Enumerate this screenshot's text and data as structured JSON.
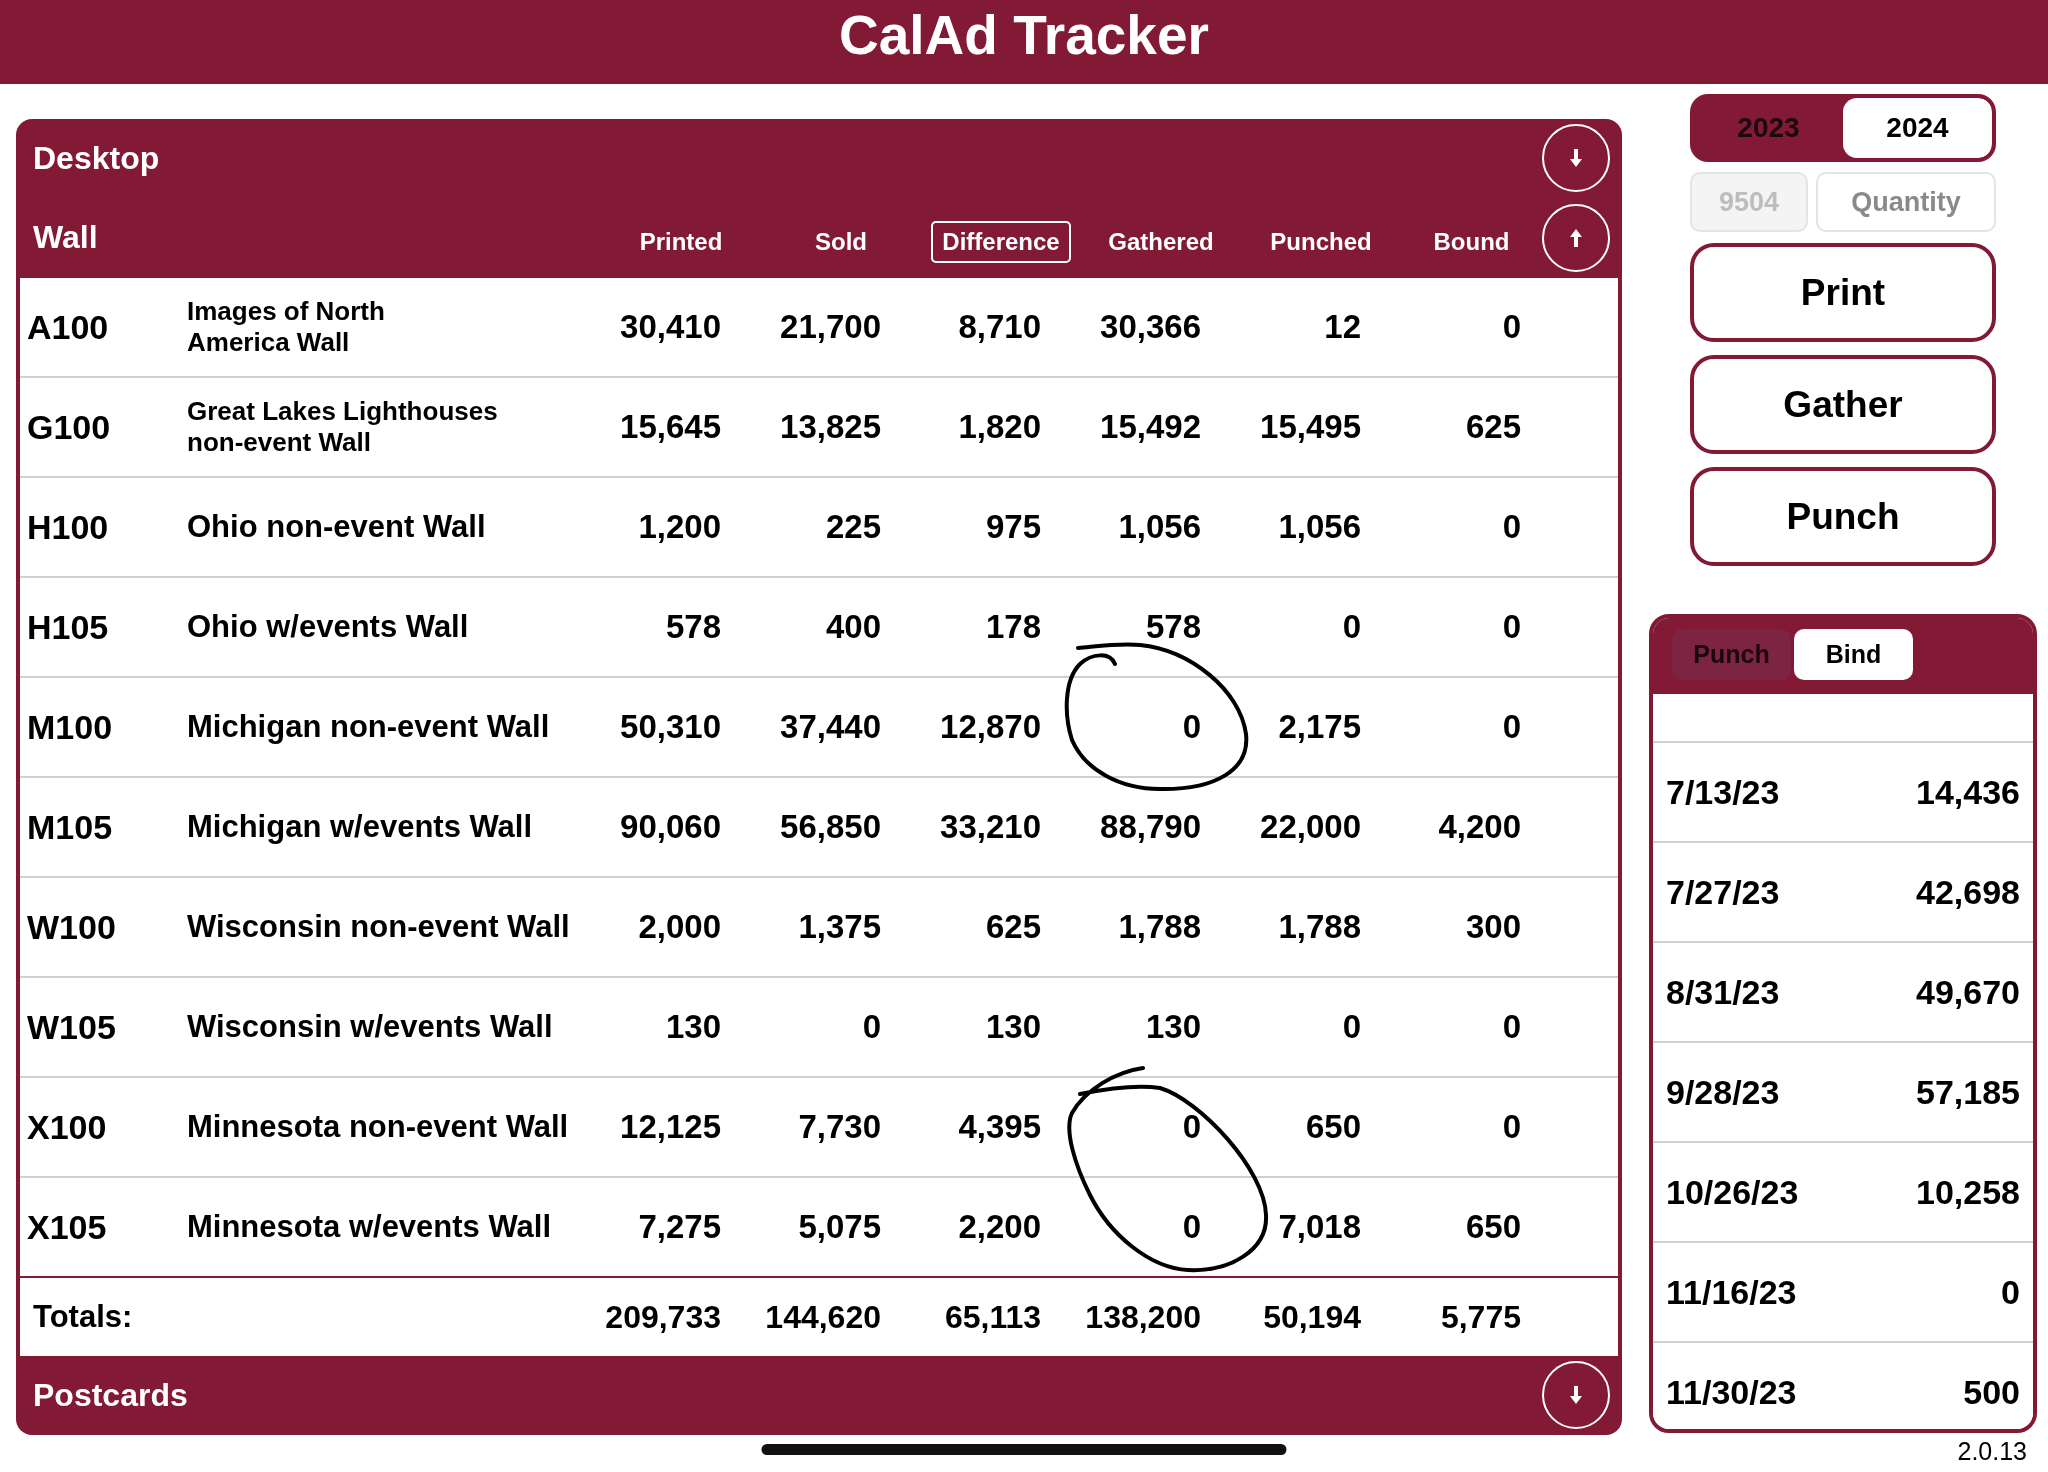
{
  "title": "CalAd Tracker",
  "table": {
    "section": "Desktop",
    "group": "Wall",
    "columns": [
      {
        "label": "Printed",
        "selected": false
      },
      {
        "label": "Sold",
        "selected": false
      },
      {
        "label": "Difference",
        "selected": true
      },
      {
        "label": "Gathered",
        "selected": false
      },
      {
        "label": "Punched",
        "selected": false
      },
      {
        "label": "Bound",
        "selected": false
      }
    ],
    "rows": [
      {
        "code": "A100",
        "name": "Images of North America Wall",
        "values": [
          "30,410",
          "21,700",
          "8,710",
          "30,366",
          "12",
          "0"
        ]
      },
      {
        "code": "G100",
        "name": "Great Lakes Lighthouses non-event Wall",
        "values": [
          "15,645",
          "13,825",
          "1,820",
          "15,492",
          "15,495",
          "625"
        ]
      },
      {
        "code": "H100",
        "name": "Ohio non-event Wall",
        "values": [
          "1,200",
          "225",
          "975",
          "1,056",
          "1,056",
          "0"
        ]
      },
      {
        "code": "H105",
        "name": "Ohio w/events Wall",
        "values": [
          "578",
          "400",
          "178",
          "578",
          "0",
          "0"
        ]
      },
      {
        "code": "M100",
        "name": "Michigan non-event Wall",
        "values": [
          "50,310",
          "37,440",
          "12,870",
          "0",
          "2,175",
          "0"
        ]
      },
      {
        "code": "M105",
        "name": "Michigan w/events Wall",
        "values": [
          "90,060",
          "56,850",
          "33,210",
          "88,790",
          "22,000",
          "4,200"
        ]
      },
      {
        "code": "W100",
        "name": "Wisconsin non-event Wall",
        "values": [
          "2,000",
          "1,375",
          "625",
          "1,788",
          "1,788",
          "300"
        ]
      },
      {
        "code": "W105",
        "name": "Wisconsin w/events Wall",
        "values": [
          "130",
          "0",
          "130",
          "130",
          "0",
          "0"
        ]
      },
      {
        "code": "X100",
        "name": "Minnesota non-event Wall",
        "values": [
          "12,125",
          "7,730",
          "4,395",
          "0",
          "650",
          "0"
        ]
      },
      {
        "code": "X105",
        "name": "Minnesota w/events Wall",
        "values": [
          "7,275",
          "5,075",
          "2,200",
          "0",
          "7,018",
          "650"
        ]
      }
    ],
    "totals": {
      "label": "Totals:",
      "values": [
        "209,733",
        "144,620",
        "65,113",
        "138,200",
        "50,194",
        "5,775"
      ]
    }
  },
  "next_section": {
    "title": "Postcards"
  },
  "year_selector": [
    {
      "label": "2023",
      "selected": true
    },
    {
      "label": "2024",
      "selected": false
    }
  ],
  "fields": [
    {
      "placeholder": "9504",
      "disabled": true
    },
    {
      "placeholder": "Quantity",
      "disabled": false
    }
  ],
  "actions": [
    "Print",
    "Gather",
    "Punch"
  ],
  "history": {
    "tabs": [
      {
        "label": "Punch",
        "selected": true
      },
      {
        "label": "Bind",
        "selected": false
      }
    ],
    "rows": [
      {
        "date": "7/13/23",
        "value": "14,436"
      },
      {
        "date": "7/27/23",
        "value": "42,698"
      },
      {
        "date": "8/31/23",
        "value": "49,670"
      },
      {
        "date": "9/28/23",
        "value": "57,185"
      },
      {
        "date": "10/26/23",
        "value": "10,258"
      },
      {
        "date": "11/16/23",
        "value": "0"
      },
      {
        "date": "11/30/23",
        "value": "500"
      }
    ]
  },
  "version": "2.0.13"
}
